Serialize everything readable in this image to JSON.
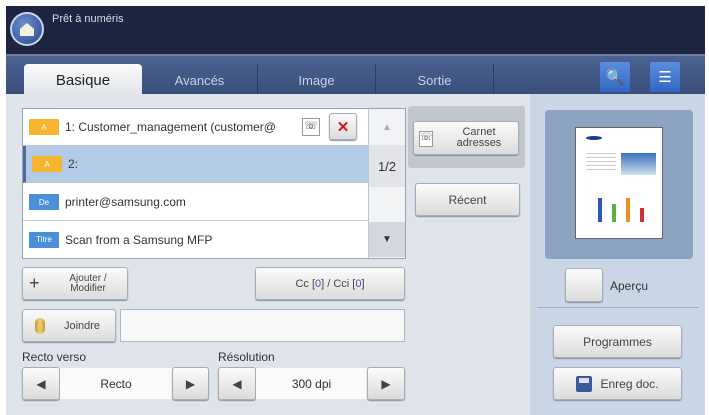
{
  "header": {
    "status": "Prêt à numéris"
  },
  "tabs": [
    {
      "label": "Basique"
    },
    {
      "label": "Avancés"
    },
    {
      "label": "Image"
    },
    {
      "label": "Sortie"
    }
  ],
  "recipients": [
    {
      "badge": "A",
      "text": "1: Customer_management (customer@",
      "color": "#f5b52e"
    },
    {
      "badge": "A",
      "text": "2:",
      "color": "#f5b52e"
    },
    {
      "badge": "De",
      "text": "printer@samsung.com",
      "color": "#4a90d8"
    },
    {
      "badge": "Titre",
      "text": "Scan from a Samsung MFP",
      "color": "#4a90d8"
    }
  ],
  "pager": "1/2",
  "buttons": {
    "carnet": "Carnet adresses",
    "recent": "Récent",
    "ajouter": "Ajouter / Modifier",
    "cc_prefix": "Cc [",
    "cc_val": "0",
    "cc_mid": "] / Cci [",
    "cci_val": "0",
    "cc_suffix": "]",
    "joindre": "Joindre",
    "apercu": "Aperçu",
    "programmes": "Programmes",
    "enreg": "Enreg doc."
  },
  "attach_value": "",
  "duplex": {
    "label": "Recto verso",
    "value": "Recto"
  },
  "resolution": {
    "label": "Résolution",
    "value": "300 dpi"
  }
}
